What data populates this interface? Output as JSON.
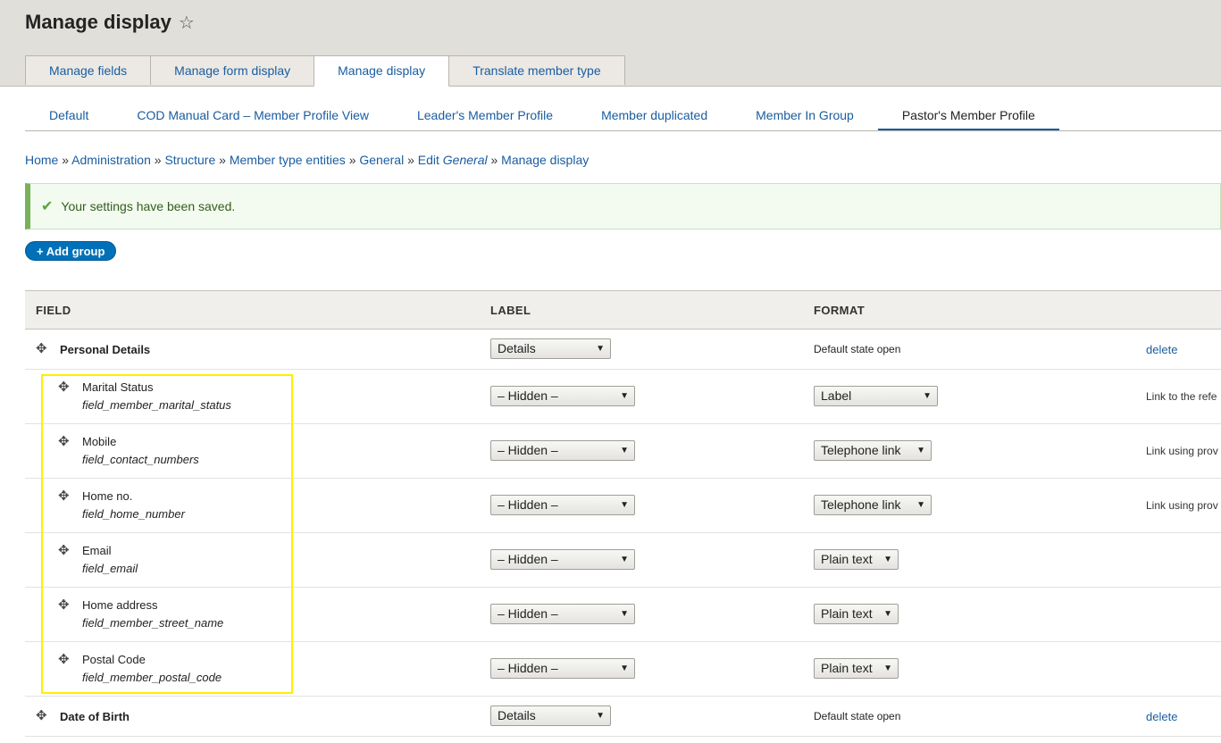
{
  "page": {
    "title": "Manage display",
    "star_icon": "star-outline-icon"
  },
  "tabs": [
    {
      "label": "Manage fields",
      "active": false
    },
    {
      "label": "Manage form display",
      "active": false
    },
    {
      "label": "Manage display",
      "active": true
    },
    {
      "label": "Translate member type",
      "active": false
    }
  ],
  "subtabs": [
    {
      "label": "Default",
      "active": false
    },
    {
      "label": "COD Manual Card – Member Profile View",
      "active": false
    },
    {
      "label": "Leader's Member Profile",
      "active": false
    },
    {
      "label": "Member duplicated",
      "active": false
    },
    {
      "label": "Member In Group",
      "active": false
    },
    {
      "label": "Pastor's Member Profile",
      "active": true
    }
  ],
  "breadcrumb": {
    "items": [
      "Home",
      "Administration",
      "Structure",
      "Member type entities",
      "General"
    ],
    "edit_prefix": "Edit",
    "edit_name": "General",
    "last": "Manage display",
    "separator": "»"
  },
  "message": {
    "text": "Your settings have been saved.",
    "icon": "check-icon",
    "color": "#77b259"
  },
  "add_group": {
    "label": "+ Add group"
  },
  "table": {
    "headers": {
      "field": "FIELD",
      "label": "LABEL",
      "format": "FORMAT"
    },
    "rows": [
      {
        "type": "group",
        "name": "Personal Details",
        "label": "Details",
        "format": "Default state open",
        "action": "delete"
      },
      {
        "type": "field",
        "name": "Marital Status",
        "machine": "field_member_marital_status",
        "label": "– Hidden –",
        "format": "Label",
        "summary": "Link to the refe"
      },
      {
        "type": "field",
        "name": "Mobile",
        "machine": "field_contact_numbers",
        "label": "– Hidden –",
        "format": "Telephone link",
        "summary": "Link using prov"
      },
      {
        "type": "field",
        "name": "Home no.",
        "machine": "field_home_number",
        "label": "– Hidden –",
        "format": "Telephone link",
        "summary": "Link using prov"
      },
      {
        "type": "field",
        "name": "Email",
        "machine": "field_email",
        "label": "– Hidden –",
        "format": "Plain text",
        "summary": ""
      },
      {
        "type": "field",
        "name": "Home address",
        "machine": "field_member_street_name",
        "label": "– Hidden –",
        "format": "Plain text",
        "summary": ""
      },
      {
        "type": "field",
        "name": "Postal Code",
        "machine": "field_member_postal_code",
        "label": "– Hidden –",
        "format": "Plain text",
        "summary": ""
      },
      {
        "type": "group",
        "name": "Date of Birth",
        "label": "Details",
        "format": "Default state open",
        "action": "delete"
      }
    ]
  },
  "colors": {
    "link": "#1a5da0",
    "header_bg": "#e1dfd9",
    "button": "#0071b8",
    "highlight": "#ffef00"
  }
}
